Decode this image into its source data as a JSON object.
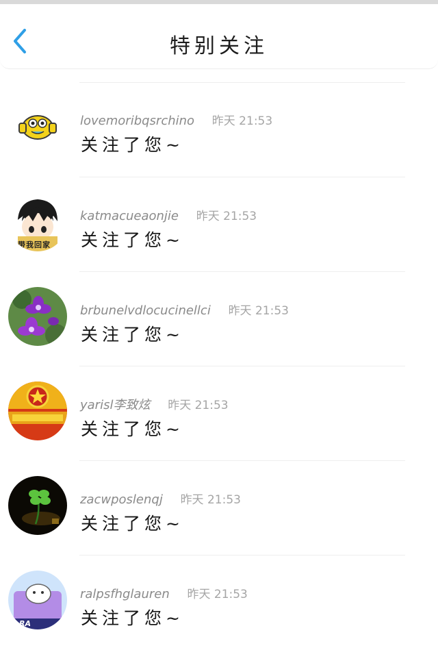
{
  "header": {
    "title": "特别关注",
    "back_icon": "chevron-left-icon",
    "accent": "#2f9fe6"
  },
  "items": [
    {
      "username": "lovemoribqsrchino",
      "time": "昨天 21:53",
      "message": "关注了您~",
      "avatar": "yellow-emoji-avatar"
    },
    {
      "username": "katmacueaonjie",
      "time": "昨天 21:53",
      "message": "关注了您~",
      "avatar": "anime-boy-avatar",
      "avatar_text": "带我回家"
    },
    {
      "username": "brbunelvdlocucinellci",
      "time": "昨天 21:53",
      "message": "关注了您~",
      "avatar": "purple-flower-avatar"
    },
    {
      "username": "yarisl李致炫",
      "time": "昨天 21:53",
      "message": "关注了您~",
      "avatar": "red-star-emblem-avatar"
    },
    {
      "username": "zacwposlenqj",
      "time": "昨天 21:53",
      "message": "关注了您~",
      "avatar": "four-leaf-clover-avatar"
    },
    {
      "username": "ralpsfhglauren",
      "time": "昨天 21:53",
      "message": "关注了您~",
      "avatar": "cartoon-cat-avatar",
      "avatar_text": "RA"
    }
  ]
}
